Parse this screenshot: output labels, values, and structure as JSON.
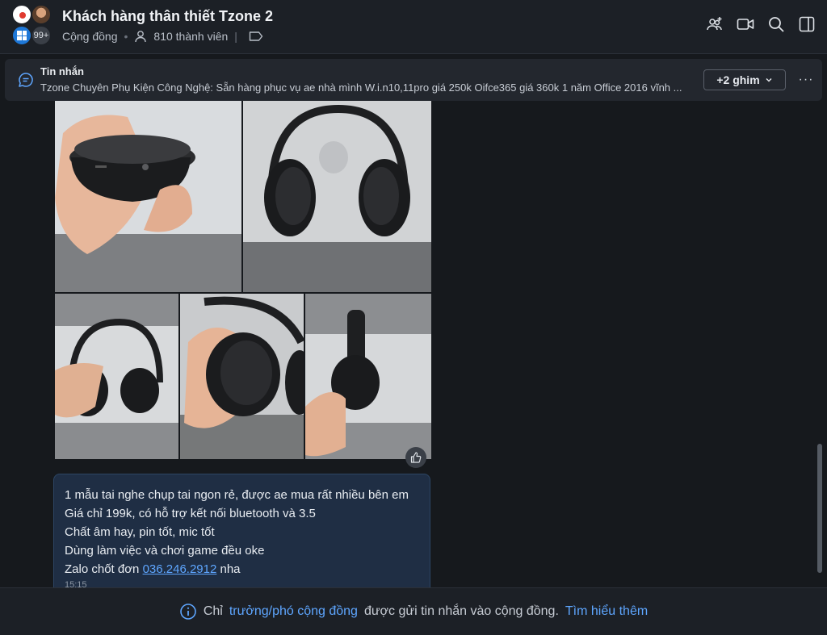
{
  "header": {
    "title": "Khách hàng thân thiết Tzone 2",
    "community_label": "Cộng đồng",
    "members_label": "810 thành viên",
    "avatar_badge": "99+",
    "icons": [
      "add-member-icon",
      "video-call-icon",
      "search-icon",
      "sidebar-toggle-icon"
    ]
  },
  "pinned": {
    "title": "Tin nhắn",
    "text": "Tzone Chuyên Phụ Kiện Công Nghệ: Sẵn hàng phục vụ ae nhà mình W.i.n10,11pro giá 250k Oifce365 giá 360k 1 năm Office 2016 vĩnh ...",
    "more_label": "+2 ghim",
    "menu_label": "···"
  },
  "message": {
    "lines": [
      "1 mẫu tai nghe chụp tai ngon rẻ, được ae mua rất nhiều bên em",
      "Giá chỉ 199k, có hỗ trợ kết nối bluetooth và 3.5",
      "Chất âm hay, pin tốt, mic tốt",
      "Dùng làm việc và chơi game đều oke"
    ],
    "last_prefix": "Zalo chốt đơn",
    "phone": "036.246.2912",
    "last_suffix": "nha",
    "time": "15:15"
  },
  "footer": {
    "prefix": "Chỉ",
    "role_link": "trưởng/phó cộng đồng",
    "middle": "được gửi tin nhắn vào cộng đồng.",
    "learn_more": "Tìm hiểu thêm"
  },
  "colors": {
    "background": "#16191d",
    "header": "#1c2026",
    "bubble": "#1f2e44",
    "link": "#5ea6ff"
  }
}
